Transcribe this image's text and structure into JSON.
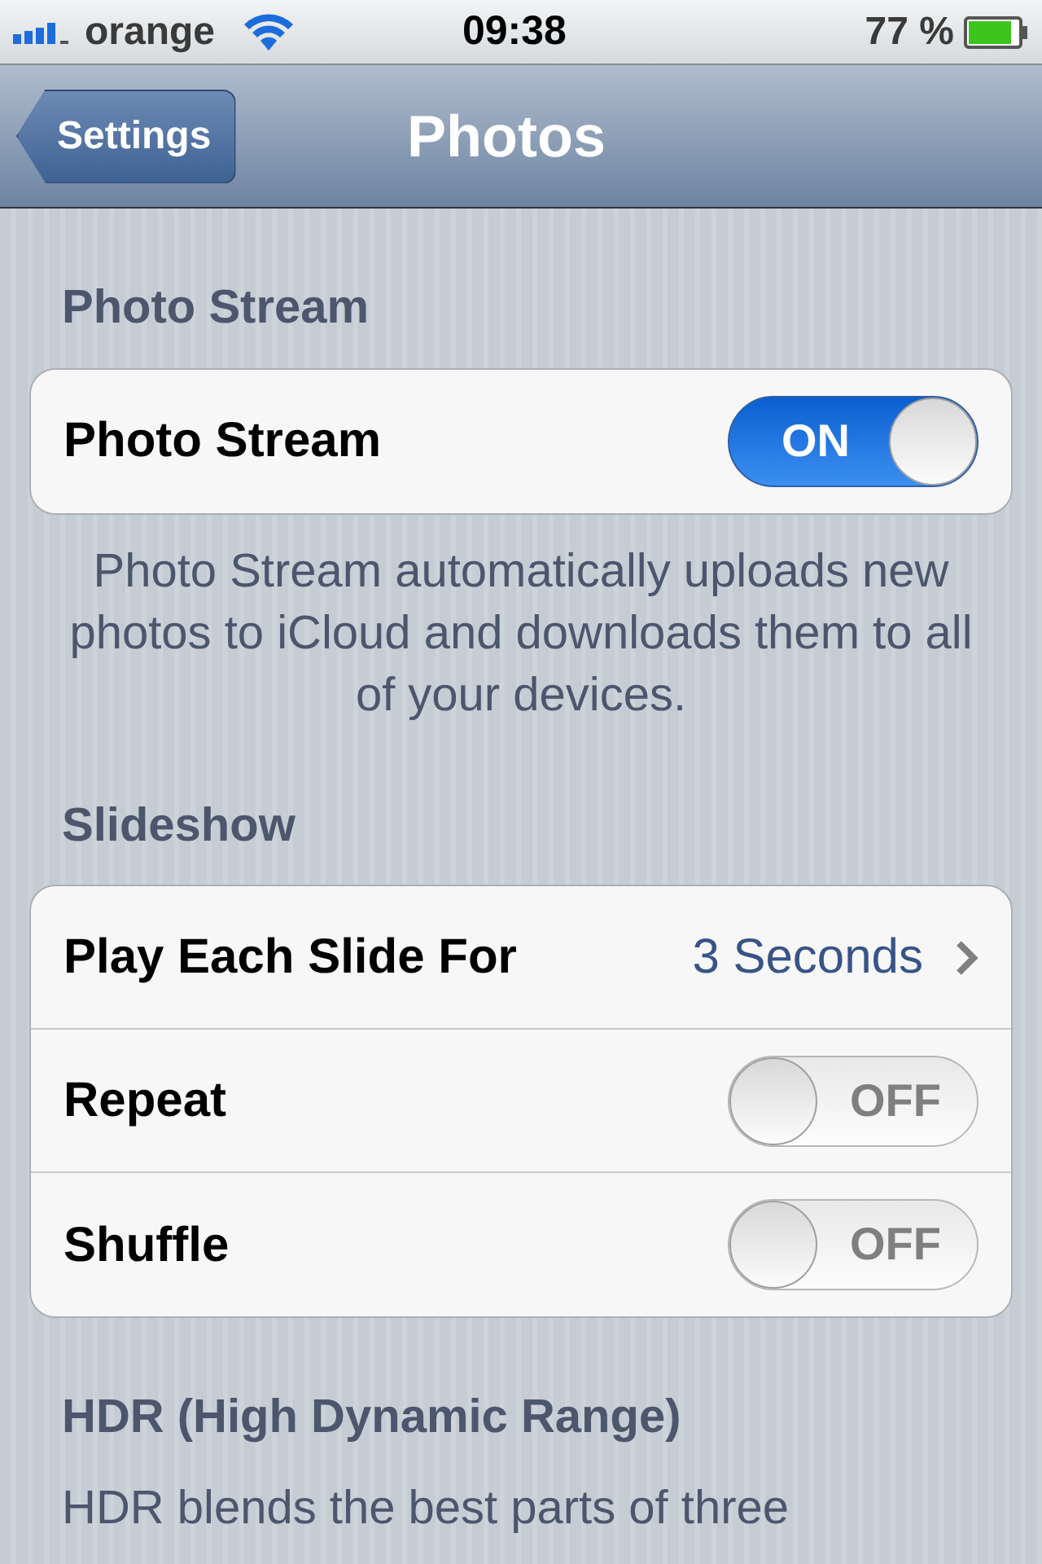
{
  "status_bar": {
    "carrier": "orange",
    "time": "09:38",
    "battery": "77 %"
  },
  "nav_bar": {
    "back": "Settings",
    "title": "Photos"
  },
  "sections": [
    {
      "header": "Photo Stream",
      "rows": [
        {
          "kind": "switch",
          "label": "Photo Stream",
          "on": true,
          "text": "ON"
        }
      ],
      "footer": "Photo Stream automatically uploads new photos to iCloud and downloads them to all of your devices."
    },
    {
      "header": "Slideshow",
      "rows": [
        {
          "kind": "disclosure",
          "label": "Play Each Slide For",
          "value": "3 Seconds"
        },
        {
          "kind": "switch",
          "label": "Repeat",
          "on": false,
          "text": "OFF"
        },
        {
          "kind": "switch",
          "label": "Shuffle",
          "on": false,
          "text": "OFF"
        }
      ]
    },
    {
      "header": "HDR (High Dynamic Range)",
      "footer": "HDR blends the best parts of three"
    }
  ]
}
